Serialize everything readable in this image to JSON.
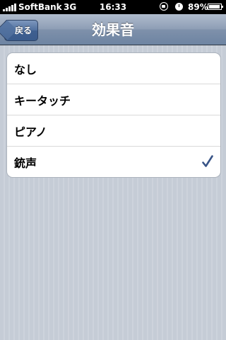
{
  "status_bar": {
    "carrier": "SoftBank",
    "network": "3G",
    "time": "16:33",
    "battery": "89%",
    "icons": [
      "signal-icon",
      "rotation-lock-icon",
      "alarm-icon",
      "battery-icon"
    ]
  },
  "nav": {
    "back_label": "戻る",
    "title": "効果音"
  },
  "options": [
    {
      "label": "なし",
      "selected": false
    },
    {
      "label": "キータッチ",
      "selected": false
    },
    {
      "label": "ピアノ",
      "selected": false
    },
    {
      "label": "銃声",
      "selected": true
    }
  ],
  "colors": {
    "checkmark": "#385487",
    "navbar": "#6d84a2"
  }
}
